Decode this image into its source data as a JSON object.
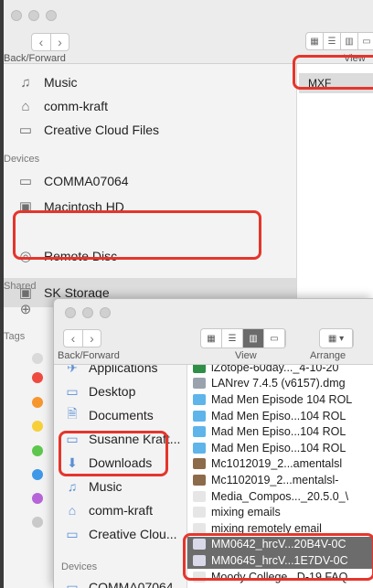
{
  "back_window": {
    "nav_label": "Back/Forward",
    "view_label": "View",
    "selected_file": "MXF",
    "sidebar": {
      "favorites": [
        {
          "label": "Music",
          "icon": "music-note-icon"
        },
        {
          "label": "comm-kraft",
          "icon": "home-icon"
        },
        {
          "label": "Creative Cloud Files",
          "icon": "folder-icon"
        }
      ],
      "devices_heading": "Devices",
      "devices": [
        {
          "label": "COMMA07064",
          "icon": "laptop-icon"
        },
        {
          "label": "Macintosh HD",
          "icon": "hard-drive-icon"
        },
        {
          "label": "SK Storage",
          "icon": "external-drive-icon"
        },
        {
          "label": "Remote Disc",
          "icon": "disc-icon"
        }
      ],
      "shared_heading": "Shared",
      "tags_heading": "Tags",
      "tag_colors": [
        "#d9d9d9",
        "#ee4b40",
        "#f5962f",
        "#f7cf38",
        "#5cc74c",
        "#3f97e8",
        "#b565d8",
        "#c9c9c9"
      ]
    }
  },
  "front_window": {
    "nav_label": "Back/Forward",
    "view_label": "View",
    "arrange_label": "Arrange",
    "sidebar": [
      {
        "label": "Applications",
        "icon": "applications-icon"
      },
      {
        "label": "Desktop",
        "icon": "desktop-icon"
      },
      {
        "label": "Documents",
        "icon": "documents-icon"
      },
      {
        "label": "Susanne Kraft...",
        "icon": "folder-icon"
      },
      {
        "label": "Downloads",
        "icon": "downloads-icon"
      },
      {
        "label": "Music",
        "icon": "music-note-icon"
      },
      {
        "label": "comm-kraft",
        "icon": "home-icon"
      },
      {
        "label": "Creative Clou...",
        "icon": "folder-icon"
      }
    ],
    "devices_heading": "Devices",
    "devices": [
      {
        "label": "COMMA07064",
        "icon": "laptop-icon"
      }
    ],
    "files": [
      {
        "name": "iZotope-60day..._4-10-20",
        "kind": "excel",
        "selected": false
      },
      {
        "name": "LANrev 7.4.5 (v6157).dmg",
        "kind": "disk",
        "selected": false
      },
      {
        "name": "Mad Men Episode 104 ROL",
        "kind": "folder",
        "selected": false
      },
      {
        "name": "Mad Men Episo...104 ROL",
        "kind": "folder",
        "selected": false
      },
      {
        "name": "Mad Men Episo...104 ROL",
        "kind": "folder",
        "selected": false
      },
      {
        "name": "Mad Men Episo...104 ROL",
        "kind": "folder",
        "selected": false
      },
      {
        "name": "Mc1012019_2...amentalsl",
        "kind": "archive",
        "selected": false
      },
      {
        "name": "Mc1102019_2...mentalsl-",
        "kind": "archive",
        "selected": false
      },
      {
        "name": "Media_Compos..._20.5.0_\\",
        "kind": "doc",
        "selected": false
      },
      {
        "name": "mixing emails",
        "kind": "doc",
        "selected": false
      },
      {
        "name": "mixing remotely email",
        "kind": "doc",
        "selected": false
      },
      {
        "name": "MM0642_hrcV...20B4V-0C",
        "kind": "mxf",
        "selected": true
      },
      {
        "name": "MM0645_hrcV...1E7DV-0C",
        "kind": "mxf",
        "selected": true
      },
      {
        "name": "Moody College...D-19 FAQ",
        "kind": "doc",
        "selected": false
      }
    ],
    "file_icon_colors": {
      "excel": "#2f8f46",
      "disk": "#9aa3ad",
      "folder": "#5fb4ea",
      "archive": "#8c6b4a",
      "doc": "#e6e6e6",
      "mxf": "#d8d8e8"
    }
  },
  "highlight_color": "#e5352b"
}
